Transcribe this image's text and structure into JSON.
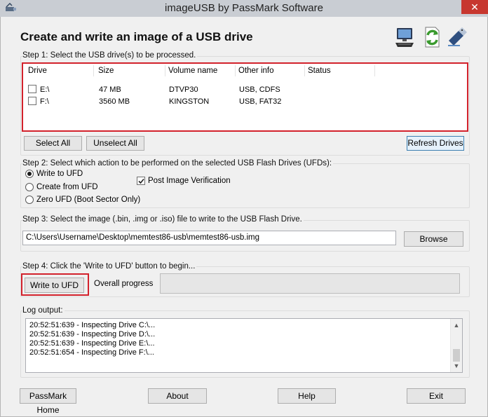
{
  "window": {
    "title": "imageUSB by PassMark Software",
    "close_glyph": "✕"
  },
  "heading": "Create and write an image of a USB drive",
  "step1": {
    "label": "Step 1: Select the USB drive(s) to be processed.",
    "columns": [
      "Drive",
      "Size",
      "Volume name",
      "Other info",
      "Status"
    ],
    "rows": [
      {
        "checked": false,
        "drive": "E:\\",
        "size": "47 MB",
        "volume": "DTVP30",
        "info": "USB, CDFS",
        "status": ""
      },
      {
        "checked": false,
        "drive": "F:\\",
        "size": "3560 MB",
        "volume": "KINGSTON",
        "info": "USB, FAT32",
        "status": ""
      }
    ],
    "select_all": "Select All",
    "unselect_all": "Unselect All",
    "refresh": "Refresh Drives"
  },
  "step2": {
    "label": "Step 2: Select which action to be performed on the selected USB Flash Drives (UFDs):",
    "options": [
      {
        "label": "Write to UFD",
        "selected": true
      },
      {
        "label": "Create from UFD",
        "selected": false
      },
      {
        "label": "Zero UFD (Boot Sector Only)",
        "selected": false
      }
    ],
    "verify": {
      "label": "Post Image Verification",
      "checked": true
    }
  },
  "step3": {
    "label": "Step 3: Select the image (.bin, .img or .iso) file to write to the USB Flash Drive.",
    "path": "C:\\Users\\Username\\Desktop\\memtest86-usb\\memtest86-usb.img",
    "browse": "Browse"
  },
  "step4": {
    "label": "Step 4: Click the 'Write to UFD' button to begin...",
    "write_button": "Write to UFD",
    "progress_label": "Overall progress",
    "progress_value": 0
  },
  "log": {
    "label": "Log output:",
    "lines": [
      "20:52:51:639 - Inspecting Drive C:\\...",
      "20:52:51:639 - Inspecting Drive D:\\...",
      "20:52:51:639 - Inspecting Drive E:\\...",
      "20:52:51:654 - Inspecting Drive F:\\..."
    ]
  },
  "footer": {
    "home": "PassMark Home",
    "about": "About",
    "help": "Help",
    "exit": "Exit"
  },
  "icons": [
    "computer-icon",
    "refresh-arrows-icon",
    "usb-drive-icon"
  ],
  "colors": {
    "highlight_red": "#d3222c",
    "focus_blue": "#3c7fb1"
  }
}
